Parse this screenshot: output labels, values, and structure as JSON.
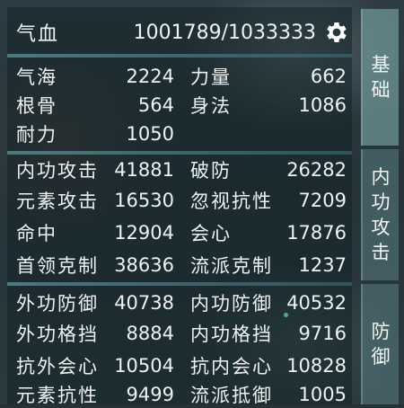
{
  "hp": {
    "label": "气血",
    "value": "1001789/1033333",
    "settings_icon": "gear-icon"
  },
  "sections": {
    "basic": {
      "stats": [
        {
          "name": "气海",
          "value": "2224"
        },
        {
          "name": "力量",
          "value": "662"
        },
        {
          "name": "根骨",
          "value": "564"
        },
        {
          "name": "身法",
          "value": "1086"
        },
        {
          "name": "耐力",
          "value": "1050"
        }
      ]
    },
    "internal_attack": {
      "stats": [
        {
          "name": "内功攻击",
          "value": "41881"
        },
        {
          "name": "破防",
          "value": "26282"
        },
        {
          "name": "元素攻击",
          "value": "16530"
        },
        {
          "name": "忽视抗性",
          "value": "7209"
        },
        {
          "name": "命中",
          "value": "12904"
        },
        {
          "name": "会心",
          "value": "17876"
        },
        {
          "name": "首领克制",
          "value": "38636"
        },
        {
          "name": "流派克制",
          "value": "1237"
        }
      ]
    },
    "defense": {
      "stats": [
        {
          "name": "外功防御",
          "value": "40738"
        },
        {
          "name": "内功防御",
          "value": "40532"
        },
        {
          "name": "外功格挡",
          "value": "8884"
        },
        {
          "name": "内功格挡",
          "value": "9716"
        },
        {
          "name": "抗外会心",
          "value": "10504"
        },
        {
          "name": "抗内会心",
          "value": "10828"
        },
        {
          "name": "元素抗性",
          "value": "9499"
        },
        {
          "name": "流派抵御",
          "value": "1005"
        }
      ]
    }
  },
  "tabs": [
    {
      "label_1": "基",
      "label_2": "础"
    },
    {
      "label_1": "内",
      "label_2": "功",
      "label_3": "攻",
      "label_4": "击"
    },
    {
      "label_1": "防",
      "label_2": "御"
    }
  ]
}
